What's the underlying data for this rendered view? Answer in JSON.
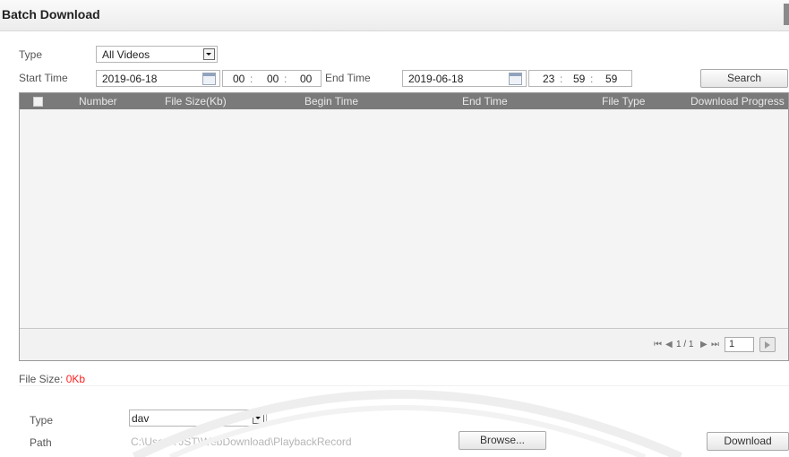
{
  "window": {
    "title": "Batch Download"
  },
  "filters": {
    "type_label": "Type",
    "type_value": "All Videos",
    "start_label": "Start Time",
    "start_date": "2019-06-18",
    "start_hh": "00",
    "start_mm": "00",
    "start_ss": "00",
    "end_label": "End Time",
    "end_date": "2019-06-18",
    "end_hh": "23",
    "end_mm": "59",
    "end_ss": "59",
    "search_label": "Search",
    "time_sep": ":"
  },
  "table": {
    "columns": [
      "Number",
      "File Size(Kb)",
      "Begin Time",
      "End Time",
      "File Type",
      "Download Progress"
    ],
    "rows": []
  },
  "pager": {
    "page_text": "1 / 1",
    "page_input": "1"
  },
  "summary": {
    "file_size_label": "File Size:",
    "file_size_value": "0Kb"
  },
  "export": {
    "type_label": "Type",
    "type_value": "dav",
    "path_label": "Path",
    "path_value": "C:\\Users\\ JST\\WebDownload\\PlaybackRecord",
    "browse_label": "Browse...",
    "download_label": "Download"
  },
  "colors": {
    "accent_red": "#ff0000",
    "header_gray": "#7a7a7a"
  }
}
